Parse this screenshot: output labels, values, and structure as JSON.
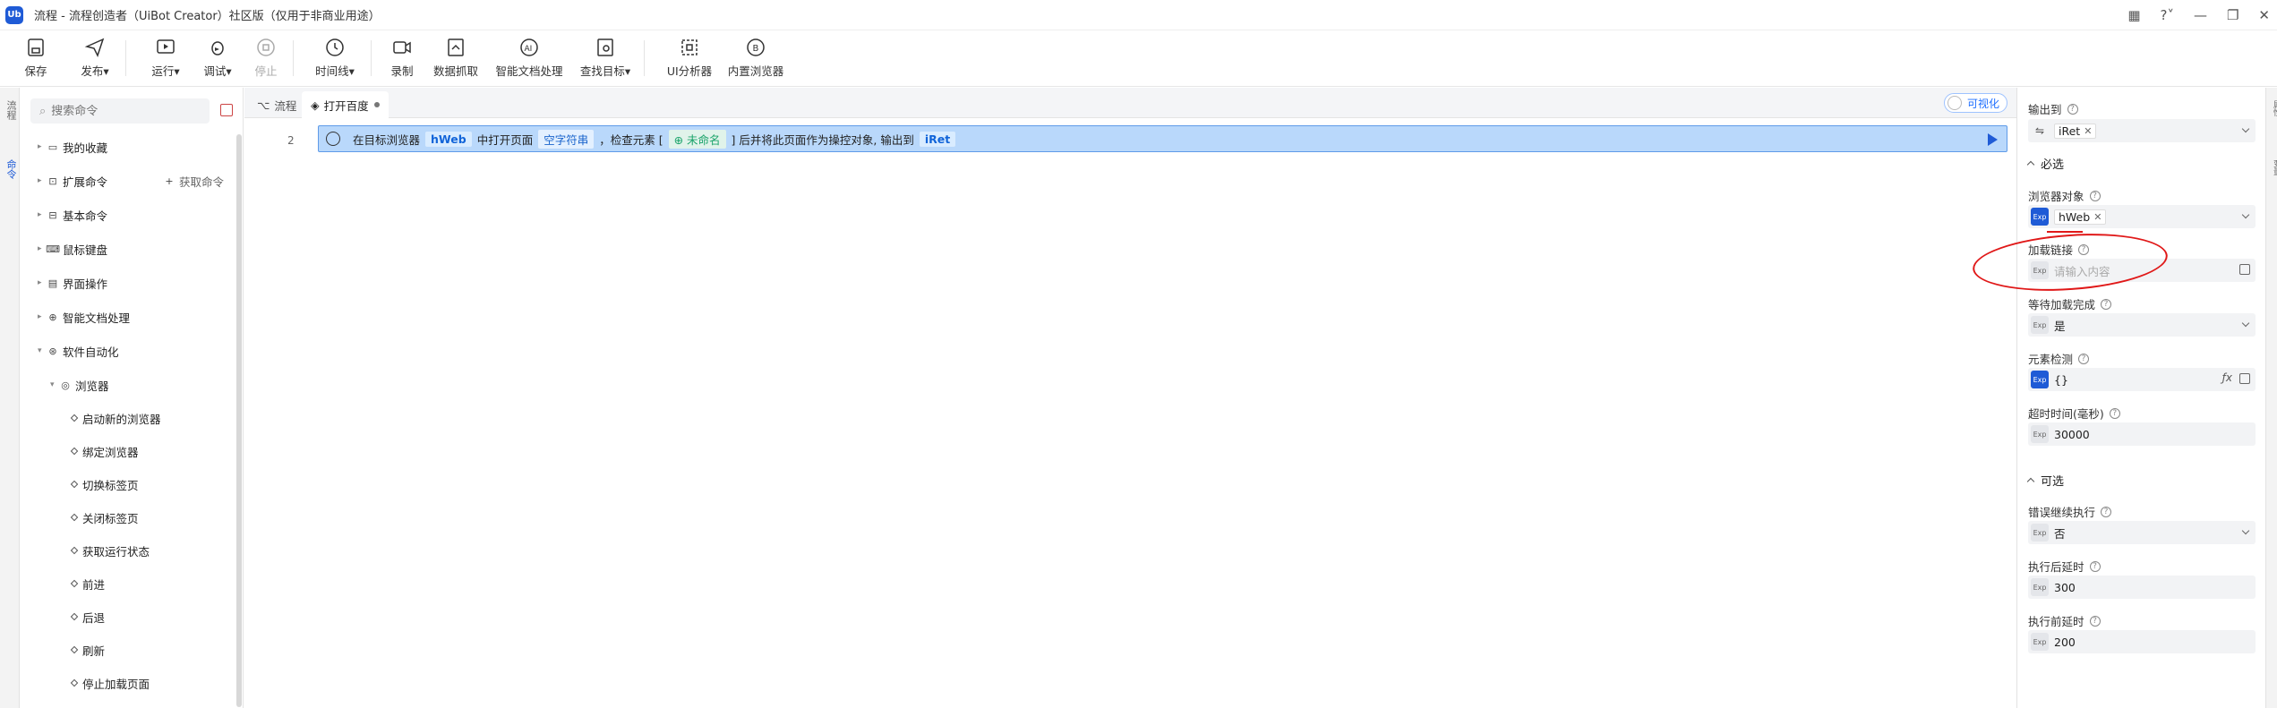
{
  "window": {
    "title": "流程 - 流程创造者（UiBot Creator）社区版（仅用于非商业用途）",
    "logo": "Ub"
  },
  "toolbar": {
    "items": [
      {
        "label": "保存",
        "icon": "save-icon"
      },
      {
        "label": "发布▾",
        "icon": "send-icon"
      },
      {
        "label": "运行▾",
        "icon": "run-icon"
      },
      {
        "label": "调试▾",
        "icon": "debug-icon"
      },
      {
        "label": "停止",
        "icon": "stop-icon",
        "disabled": true
      },
      {
        "label": "时间线▾",
        "icon": "clock-icon"
      },
      {
        "label": "录制",
        "icon": "record-icon"
      },
      {
        "label": "数据抓取",
        "icon": "data-grab-icon"
      },
      {
        "label": "智能文档处理",
        "icon": "ai-doc-icon"
      },
      {
        "label": "查找目标▾",
        "icon": "find-target-icon"
      },
      {
        "label": "UI分析器",
        "icon": "ui-analyzer-icon"
      },
      {
        "label": "内置浏览器",
        "icon": "browser-icon"
      }
    ]
  },
  "leftrail": {
    "tab1": "流程",
    "tab2": "命令"
  },
  "cmdpanel": {
    "search_placeholder": "搜索命令",
    "add_label": "获取命令",
    "tree": [
      {
        "label": "我的收藏",
        "level": 0,
        "caret": "▸"
      },
      {
        "label": "扩展命令",
        "level": 0,
        "caret": "▸"
      },
      {
        "label": "基本命令",
        "level": 0,
        "caret": "▸"
      },
      {
        "label": "鼠标键盘",
        "level": 0,
        "caret": "▸"
      },
      {
        "label": "界面操作",
        "level": 0,
        "caret": "▸"
      },
      {
        "label": "智能文档处理",
        "level": 0,
        "caret": "▸"
      },
      {
        "label": "软件自动化",
        "level": 0,
        "caret": "▾"
      },
      {
        "label": "浏览器",
        "level": 1,
        "caret": "▾"
      },
      {
        "label": "启动新的浏览器",
        "level": 2
      },
      {
        "label": "绑定浏览器",
        "level": 2
      },
      {
        "label": "切换标签页",
        "level": 2
      },
      {
        "label": "关闭标签页",
        "level": 2
      },
      {
        "label": "获取运行状态",
        "level": 2
      },
      {
        "label": "前进",
        "level": 2
      },
      {
        "label": "后退",
        "level": 2
      },
      {
        "label": "刷新",
        "level": 2
      },
      {
        "label": "停止加载页面",
        "level": 2
      }
    ]
  },
  "canvas": {
    "tabs": [
      {
        "label": "流程",
        "active": false
      },
      {
        "label": "打开百度",
        "active": true
      }
    ],
    "visual_toggle": "可视化",
    "step": {
      "line": "2",
      "t1": "在目标浏览器",
      "browser": "hWeb",
      "t2": "中打开页面",
      "url": "空字符串",
      "t3": "，检查元素 [",
      "element": "未命名",
      "t4": "] 后并将此页面作为操控对象, 输出到",
      "output": "iRet"
    }
  },
  "props": {
    "output_label": "输出到",
    "output_value": "iRet",
    "required_section": "必选",
    "browser_obj_label": "浏览器对象",
    "browser_obj_value": "hWeb",
    "url_label": "加载链接",
    "url_placeholder": "请输入内容",
    "wait_label": "等待加载完成",
    "wait_value": "是",
    "element_check_label": "元素检测",
    "element_check_value": "{}",
    "timeout_label": "超时时间(毫秒)",
    "timeout_value": "30000",
    "optional_section": "可选",
    "error_continue_label": "错误继续执行",
    "error_continue_value": "否",
    "delay_after_label": "执行后延时",
    "delay_after_value": "300",
    "delay_before_label": "执行前延时",
    "delay_before_value": "200",
    "exp_label": "Exp"
  },
  "rightrail": {
    "tab1": "属性",
    "tab2": "变量"
  },
  "colors": {
    "accent": "#1f5bd6",
    "step_bg": "#b9d8fb",
    "annotation": "#e01818"
  }
}
